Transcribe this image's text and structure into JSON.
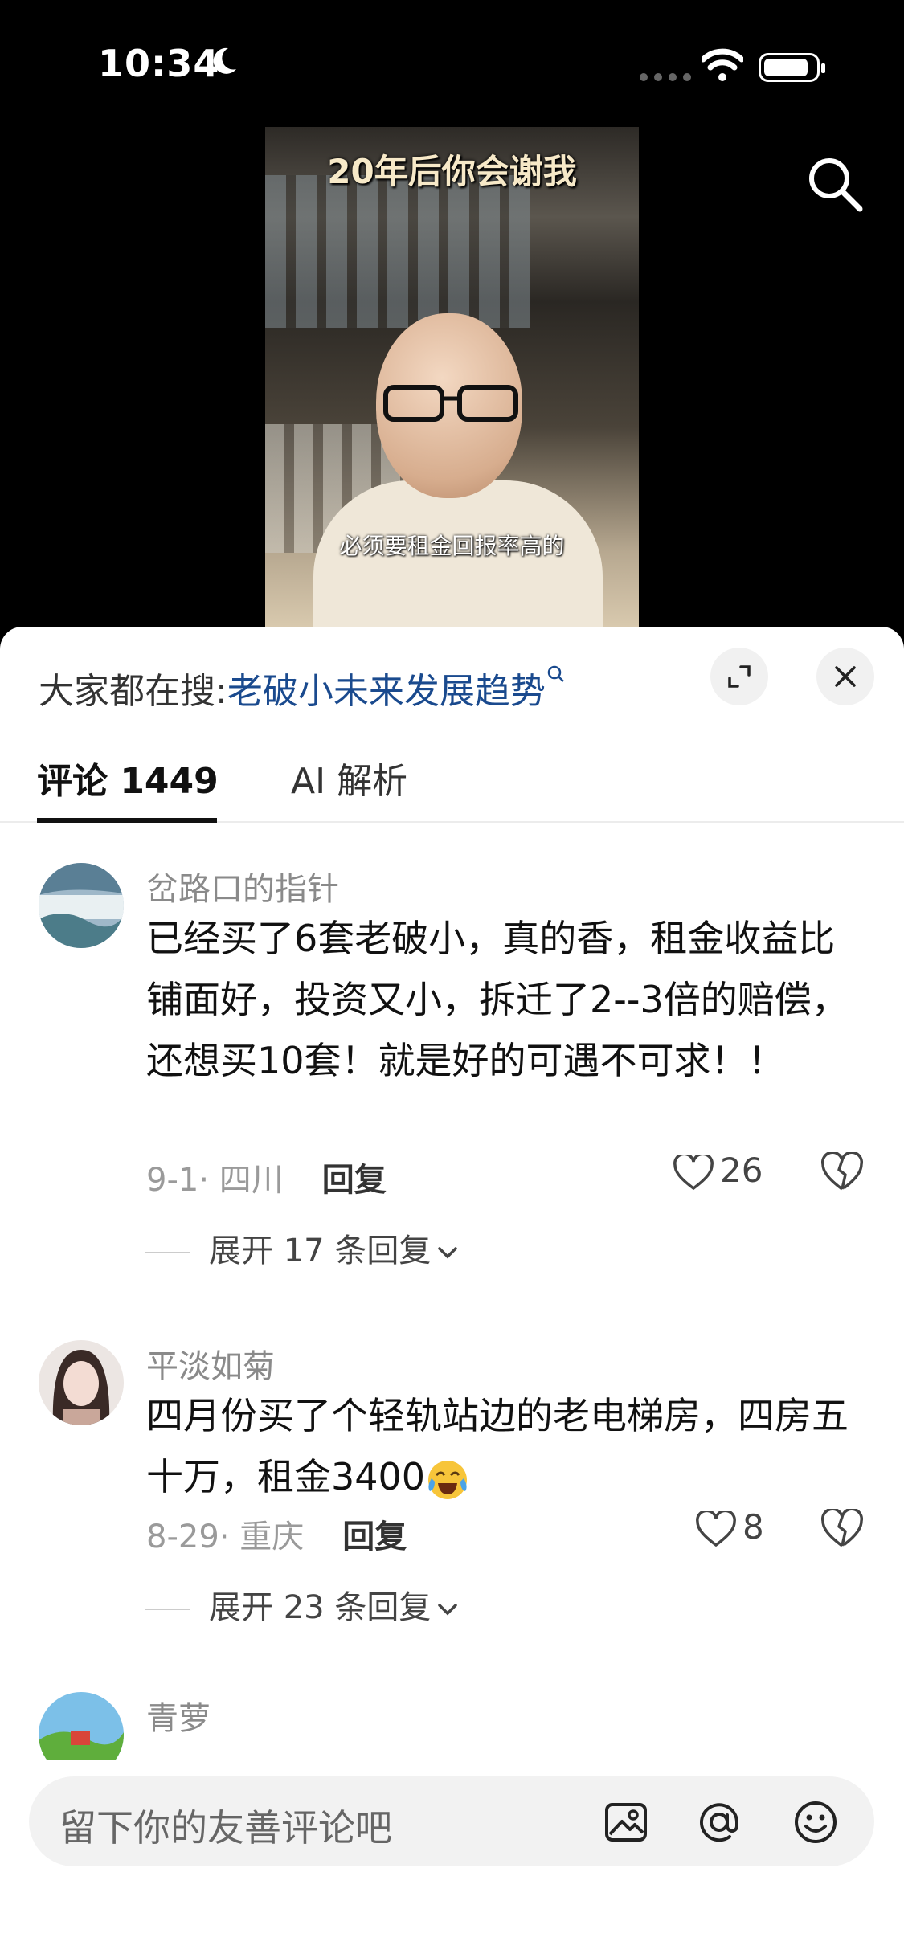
{
  "status_bar": {
    "time": "10:34"
  },
  "video": {
    "title_line": "20年后你会谢我",
    "subtitle": "必须要租金回报率高的"
  },
  "hot_search": {
    "prefix": "大家都在搜:",
    "keyword": "老破小未来发展趋势"
  },
  "tabs": [
    {
      "label": "评论 1449",
      "active": true
    },
    {
      "label": "AI 解析",
      "active": false
    }
  ],
  "comments": [
    {
      "user": "岔路口的指针",
      "text": "已经买了6套老破小，真的香，租金收益比铺面好，投资又小，拆迁了2--3倍的赔偿，还想买10套！就是好的可遇不可求！！",
      "date_loc": "9-1· 四川",
      "reply_label": "回复",
      "likes": "26",
      "expand": "展开 17 条回复"
    },
    {
      "user": "平淡如菊",
      "text": "四月份买了个轻轨站边的老电梯房，四房五十万，租金3400",
      "emoji": "laugh-cry-emoji",
      "date_loc": "8-29· 重庆",
      "reply_label": "回复",
      "likes": "8",
      "expand": "展开 23 条回复"
    },
    {
      "user": "青萝"
    }
  ],
  "input": {
    "placeholder": "留下你的友善评论吧"
  },
  "icons": [
    "moon-icon",
    "wifi-icon",
    "battery-icon",
    "search-icon",
    "expand-icon",
    "close-icon",
    "heart-icon",
    "broken-heart-icon",
    "chevron-down-icon",
    "image-icon",
    "at-icon",
    "smile-icon"
  ],
  "colors": {
    "keyword": "#1a4a8e",
    "tab_active": "#111111",
    "meta": "#9a9a9a"
  }
}
